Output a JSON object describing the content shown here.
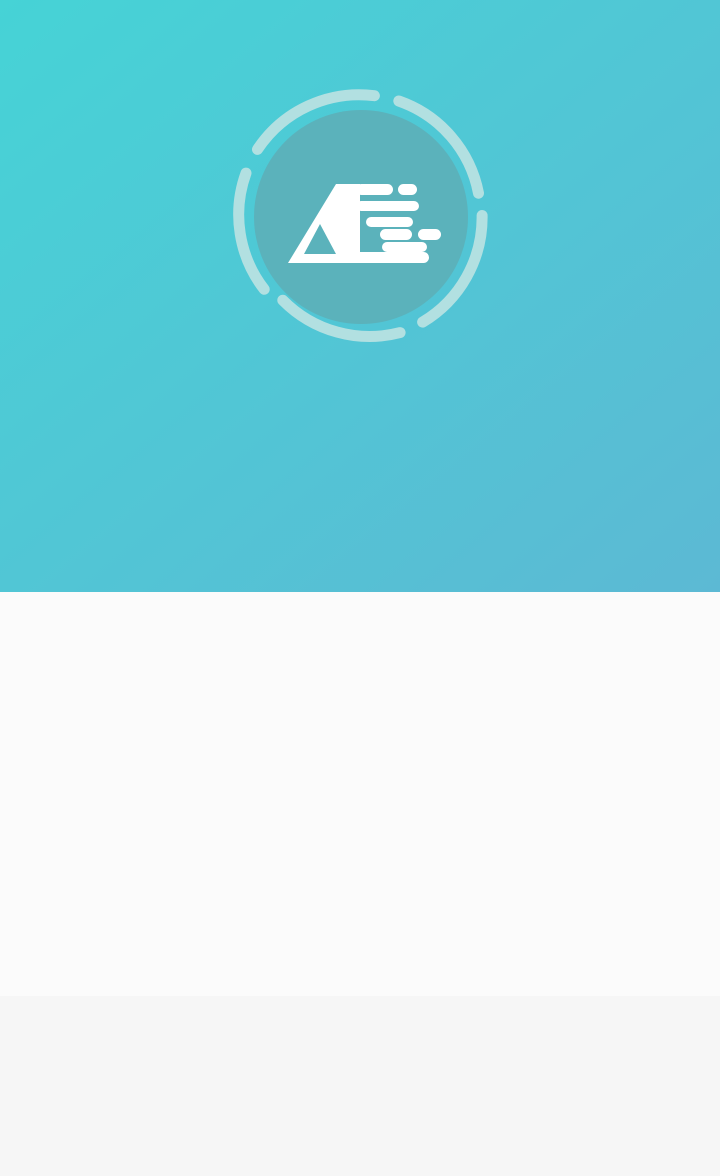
{
  "app": {
    "logo_icon": "speed-tent-logo-icon",
    "loading_ring_icon": "loading-ring-icon"
  },
  "colors": {
    "hero_gradient_start": "#46d3d6",
    "hero_gradient_end": "#5cb9d4",
    "logo_circle": "#5bb2bb",
    "logo_glyph": "#ffffff",
    "ring_segment": "#b2e0e1",
    "content_background": "#fbfbfb",
    "footer_background": "#f6f6f6"
  }
}
